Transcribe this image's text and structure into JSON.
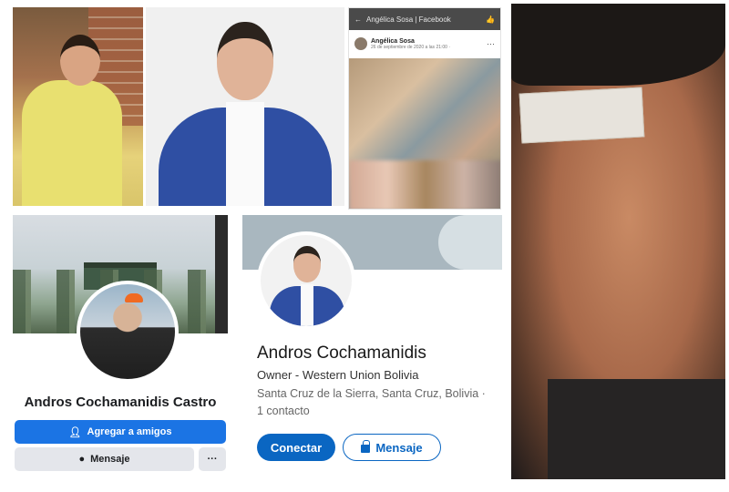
{
  "facebook_post": {
    "header_text": "Angélica Sosa | Facebook",
    "author": "Angélica Sosa",
    "date": "26 de septiembre de 2020 a las 21:00 ·",
    "menu": "···"
  },
  "facebook_profile": {
    "name": "Andros Cochamanidis Castro",
    "add_friend_label": "Agregar a amigos",
    "message_label": "Mensaje",
    "more_label": "···"
  },
  "linkedin_profile": {
    "name": "Andros Cochamanidis",
    "headline": "Owner - Western Union Bolivia",
    "location": "Santa Cruz de la Sierra, Santa Cruz, Bolivia  ·",
    "contacts": "1 contacto",
    "connect_label": "Conectar",
    "message_label": "Mensaje"
  },
  "colors": {
    "facebook_blue": "#1b74e4",
    "linkedin_blue": "#0a66c2"
  },
  "icons": {
    "add_friend": "person-plus-icon",
    "messenger": "messenger-icon",
    "lock": "lock-icon",
    "back": "back-arrow-icon",
    "like": "thumbs-up-icon"
  }
}
